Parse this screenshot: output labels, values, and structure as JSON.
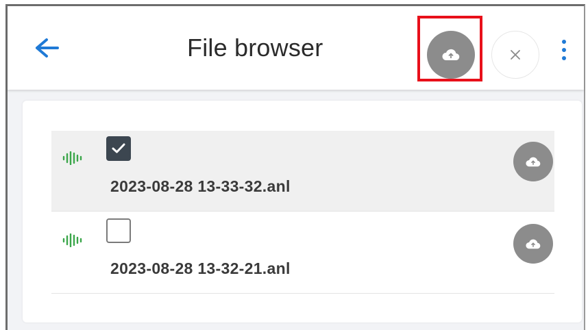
{
  "header": {
    "title": "File browser",
    "back_icon": "arrow-left-icon",
    "upload_all_icon": "cloud-upload-icon",
    "close_icon": "close-icon",
    "menu_icon": "more-vert-icon"
  },
  "files": [
    {
      "name": "2023-08-28 13-33-32.anl",
      "checked": true,
      "type_icon": "audio-wave-icon",
      "action_icon": "cloud-upload-icon"
    },
    {
      "name": "2023-08-28 13-32-21.anl",
      "checked": false,
      "type_icon": "audio-wave-icon",
      "action_icon": "cloud-upload-icon"
    }
  ],
  "colors": {
    "accent": "#1f7ad6",
    "highlight": "#e8101a",
    "wave": "#3aa64a",
    "upload_button": "#8c8c8c"
  }
}
